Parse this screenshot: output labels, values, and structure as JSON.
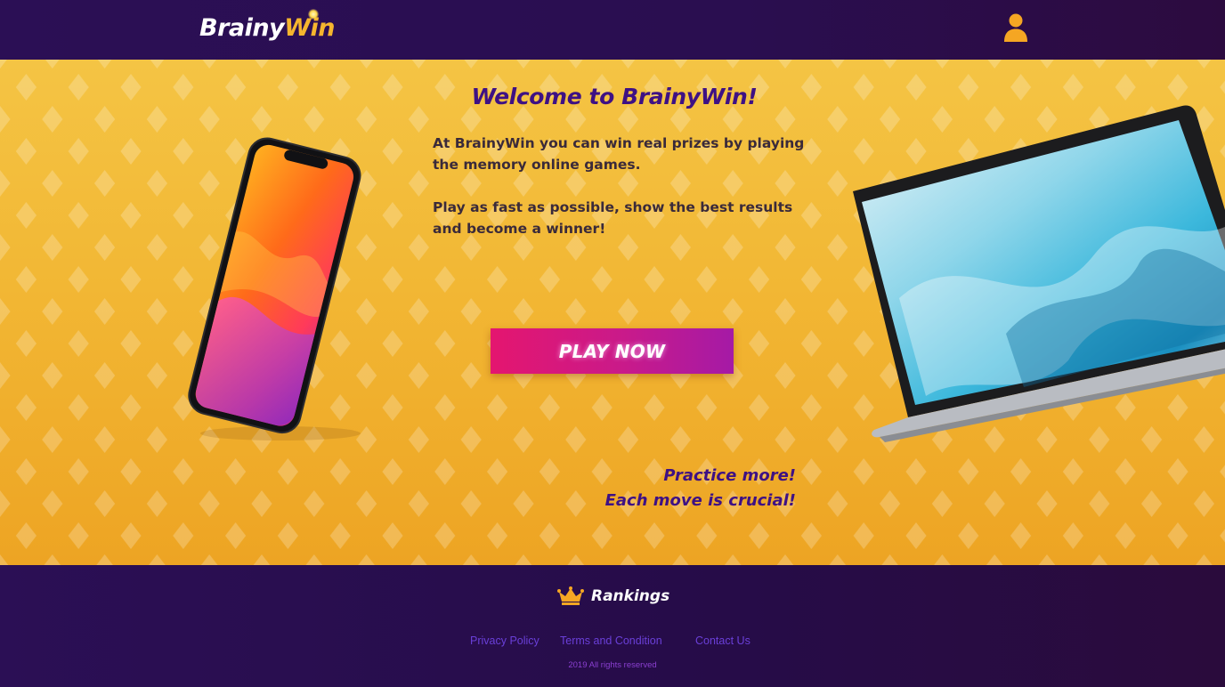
{
  "header": {
    "logo_part1": "Brainy",
    "logo_part2": "Win",
    "user_icon": "user-icon"
  },
  "hero": {
    "title": "Welcome to BrainyWin!",
    "paragraph1": "At BrainyWin you can win real prizes by playing the memory online games.",
    "paragraph2": "Play as fast as possible, show the best results and become a winner!",
    "play_button": "PLAY NOW",
    "tagline_line1": "Practice more!",
    "tagline_line2": "Each move is crucial!",
    "images": [
      "smartphone-image",
      "laptop-image"
    ]
  },
  "footer": {
    "rankings_icon": "crown-icon",
    "rankings_label": "Rankings",
    "links": [
      "Privacy Policy",
      "Terms and Condition",
      "Contact Us"
    ],
    "copyright": "2019 All rights reserved"
  },
  "colors": {
    "header_bg": "#2b0f55",
    "hero_yellow": "#f2b734",
    "title_purple": "#3e1184",
    "button_pink": "#e4166f",
    "button_purple": "#a51aa6",
    "accent_orange": "#f5a623",
    "link_purple": "#6a3fd8"
  }
}
